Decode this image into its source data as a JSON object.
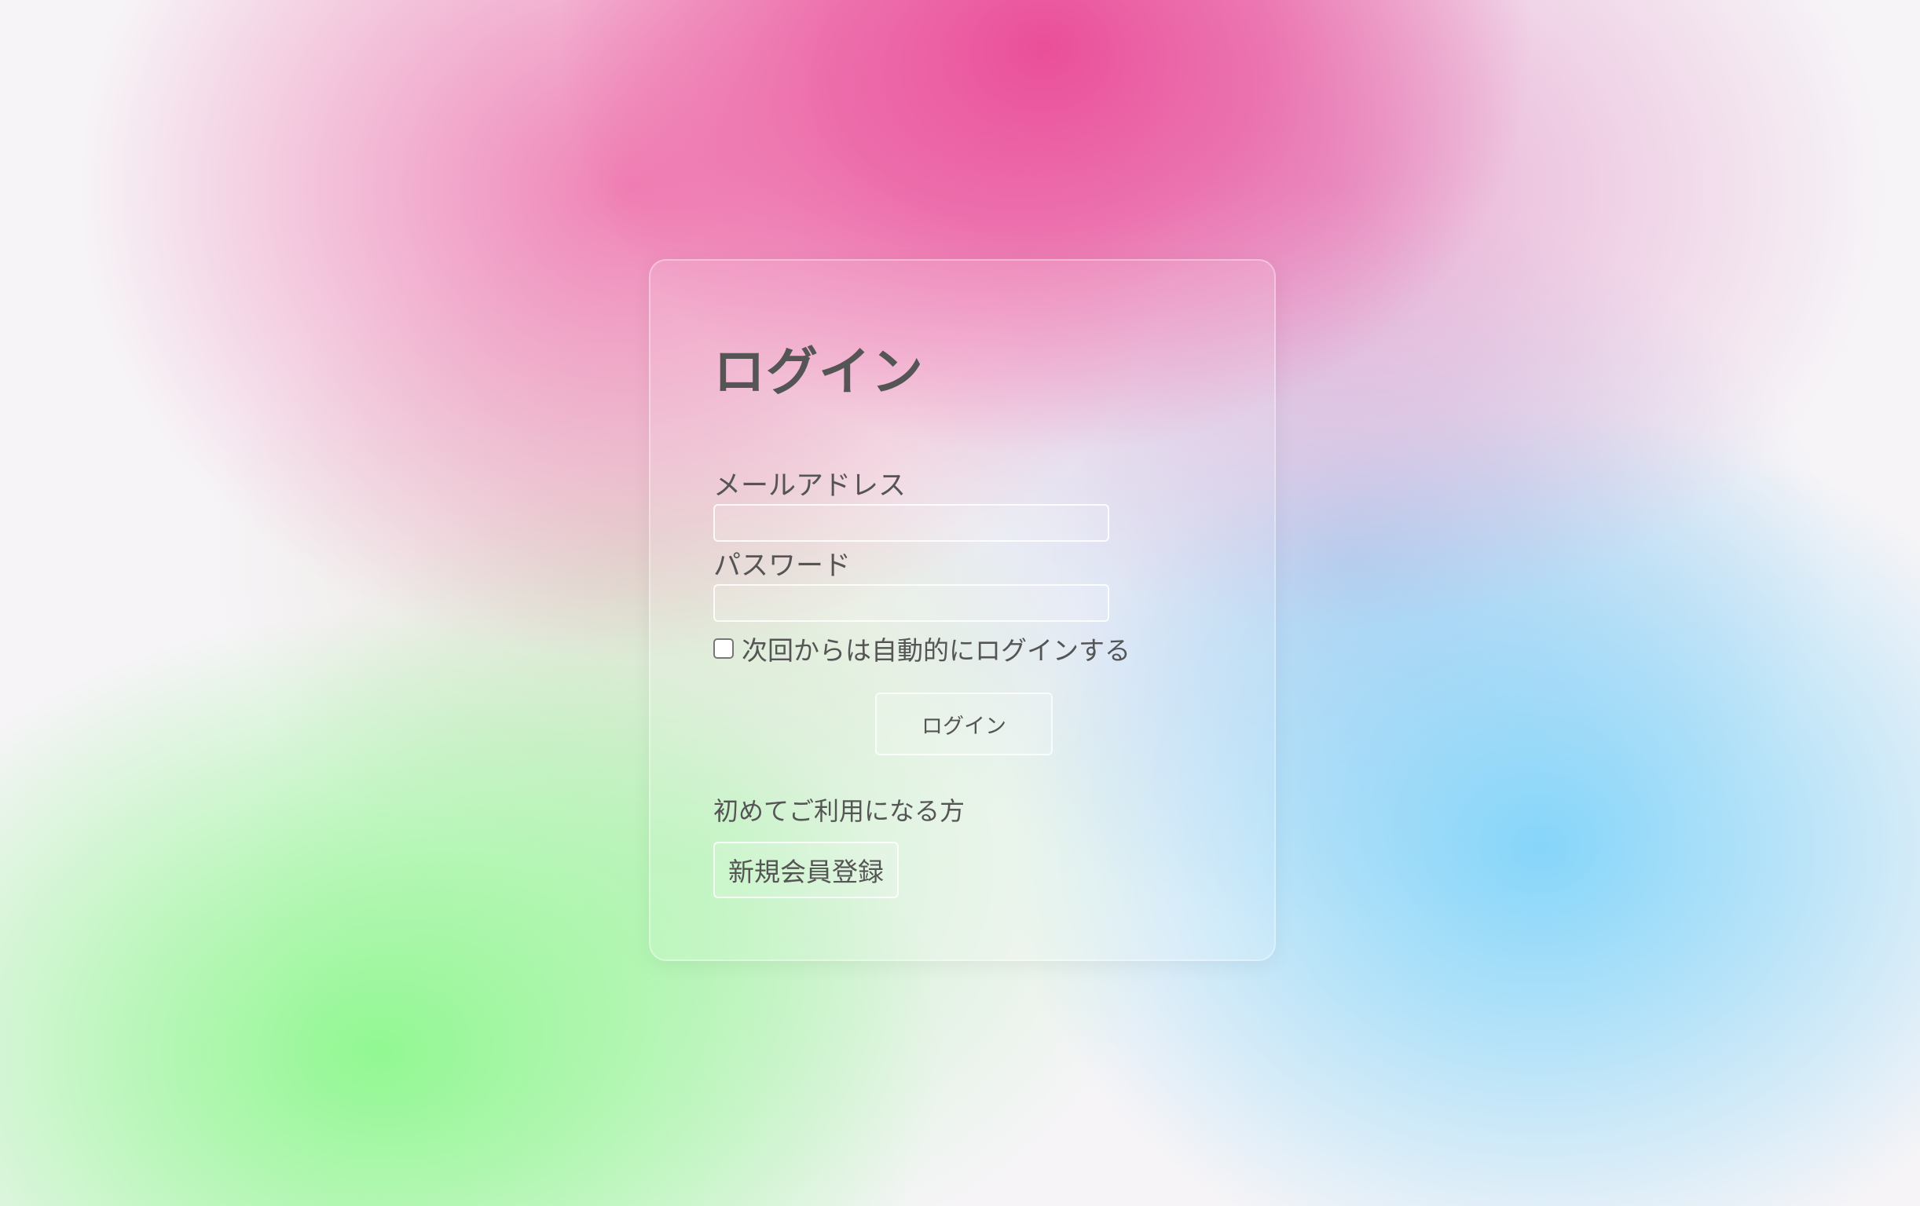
{
  "login_form": {
    "title": "ログイン",
    "email_label": "メールアドレス",
    "email_value": "",
    "password_label": "パスワード",
    "password_value": "",
    "remember_label": "次回からは自動的にログインする",
    "remember_checked": false,
    "submit_label": "ログイン"
  },
  "register": {
    "prompt": "初めてご利用になる方",
    "button_label": "新規会員登録"
  },
  "colors": {
    "text": "#555555",
    "background_pink": "#ea4896",
    "background_green": "#8cf88c",
    "background_blue": "#80d4fa"
  }
}
